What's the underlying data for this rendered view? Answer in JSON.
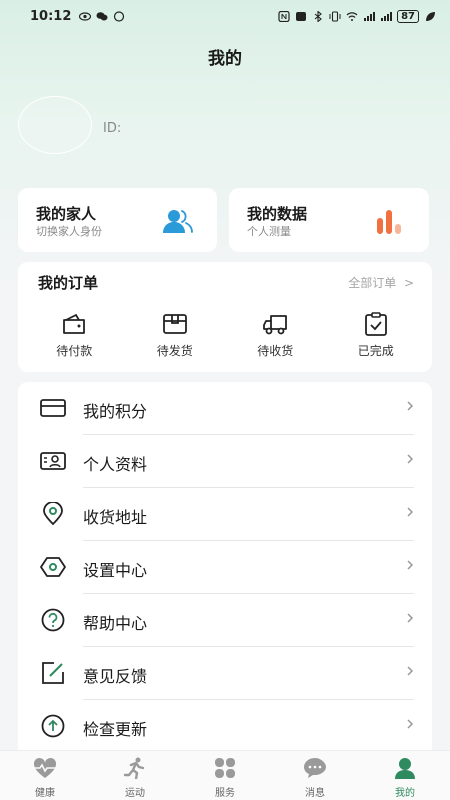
{
  "status": {
    "time": "10:12",
    "battery": "87"
  },
  "header": {
    "title": "我的"
  },
  "profile": {
    "id_label": "ID:"
  },
  "family": {
    "title": "我的家人",
    "subtitle": "切换家人身份"
  },
  "mydata": {
    "title": "我的数据",
    "subtitle": "个人测量"
  },
  "orders": {
    "title": "我的订单",
    "all_label": "全部订单",
    "items": [
      {
        "label": "待付款",
        "icon": "wallet-icon"
      },
      {
        "label": "待发货",
        "icon": "box-icon"
      },
      {
        "label": "待收货",
        "icon": "truck-icon"
      },
      {
        "label": "已完成",
        "icon": "clipboard-check-icon"
      }
    ]
  },
  "menu": {
    "items": [
      {
        "label": "我的积分",
        "icon": "card-icon"
      },
      {
        "label": "个人资料",
        "icon": "id-card-icon"
      },
      {
        "label": "收货地址",
        "icon": "location-pin-icon"
      },
      {
        "label": "设置中心",
        "icon": "settings-hexagon-icon"
      },
      {
        "label": "帮助中心",
        "icon": "help-circle-icon"
      },
      {
        "label": "意见反馈",
        "icon": "feedback-edit-icon"
      },
      {
        "label": "检查更新",
        "icon": "upload-circle-icon"
      }
    ]
  },
  "tabs": [
    {
      "label": "健康",
      "icon": "heart-pulse-icon"
    },
    {
      "label": "运动",
      "icon": "running-icon"
    },
    {
      "label": "服务",
      "icon": "grid-icon"
    },
    {
      "label": "消息",
      "icon": "chat-bubble-icon"
    },
    {
      "label": "我的",
      "icon": "person-icon"
    }
  ],
  "colors": {
    "accent": "#2f8a5f",
    "family_icon": "#2a9ad8",
    "data_icon": "#f07040"
  }
}
